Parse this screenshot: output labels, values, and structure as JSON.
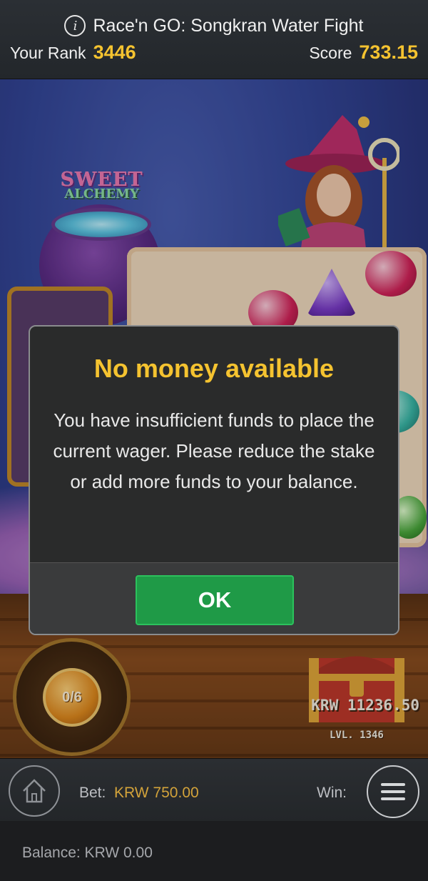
{
  "header": {
    "info_icon": "info-icon",
    "title": "Race'n GO: Songkran Water Fight",
    "rank_label": "Your Rank",
    "rank_value": "3446",
    "score_label": "Score",
    "score_value": "733.15"
  },
  "game": {
    "logo_line1": "SWEET",
    "logo_line2": "ALCHEMY",
    "coin_counter": "0/6",
    "prize_amount": "KRW 11236.50",
    "prize_level": "LVL. 1346"
  },
  "modal": {
    "title": "No money available",
    "message": "You have insufficient funds to place the current wager. Please reduce the stake or add more funds to your balance.",
    "ok_label": "OK"
  },
  "controls": {
    "home_icon": "home-icon",
    "bet_label": "Bet:",
    "bet_value": "KRW 750.00",
    "win_label": "Win:",
    "menu_icon": "hamburger-menu-icon"
  },
  "balance": {
    "text": "Balance: KRW 0.00"
  },
  "colors": {
    "accent_yellow": "#f5c330",
    "ok_green": "#1f9a47",
    "bet_gold": "#d3a33a"
  }
}
